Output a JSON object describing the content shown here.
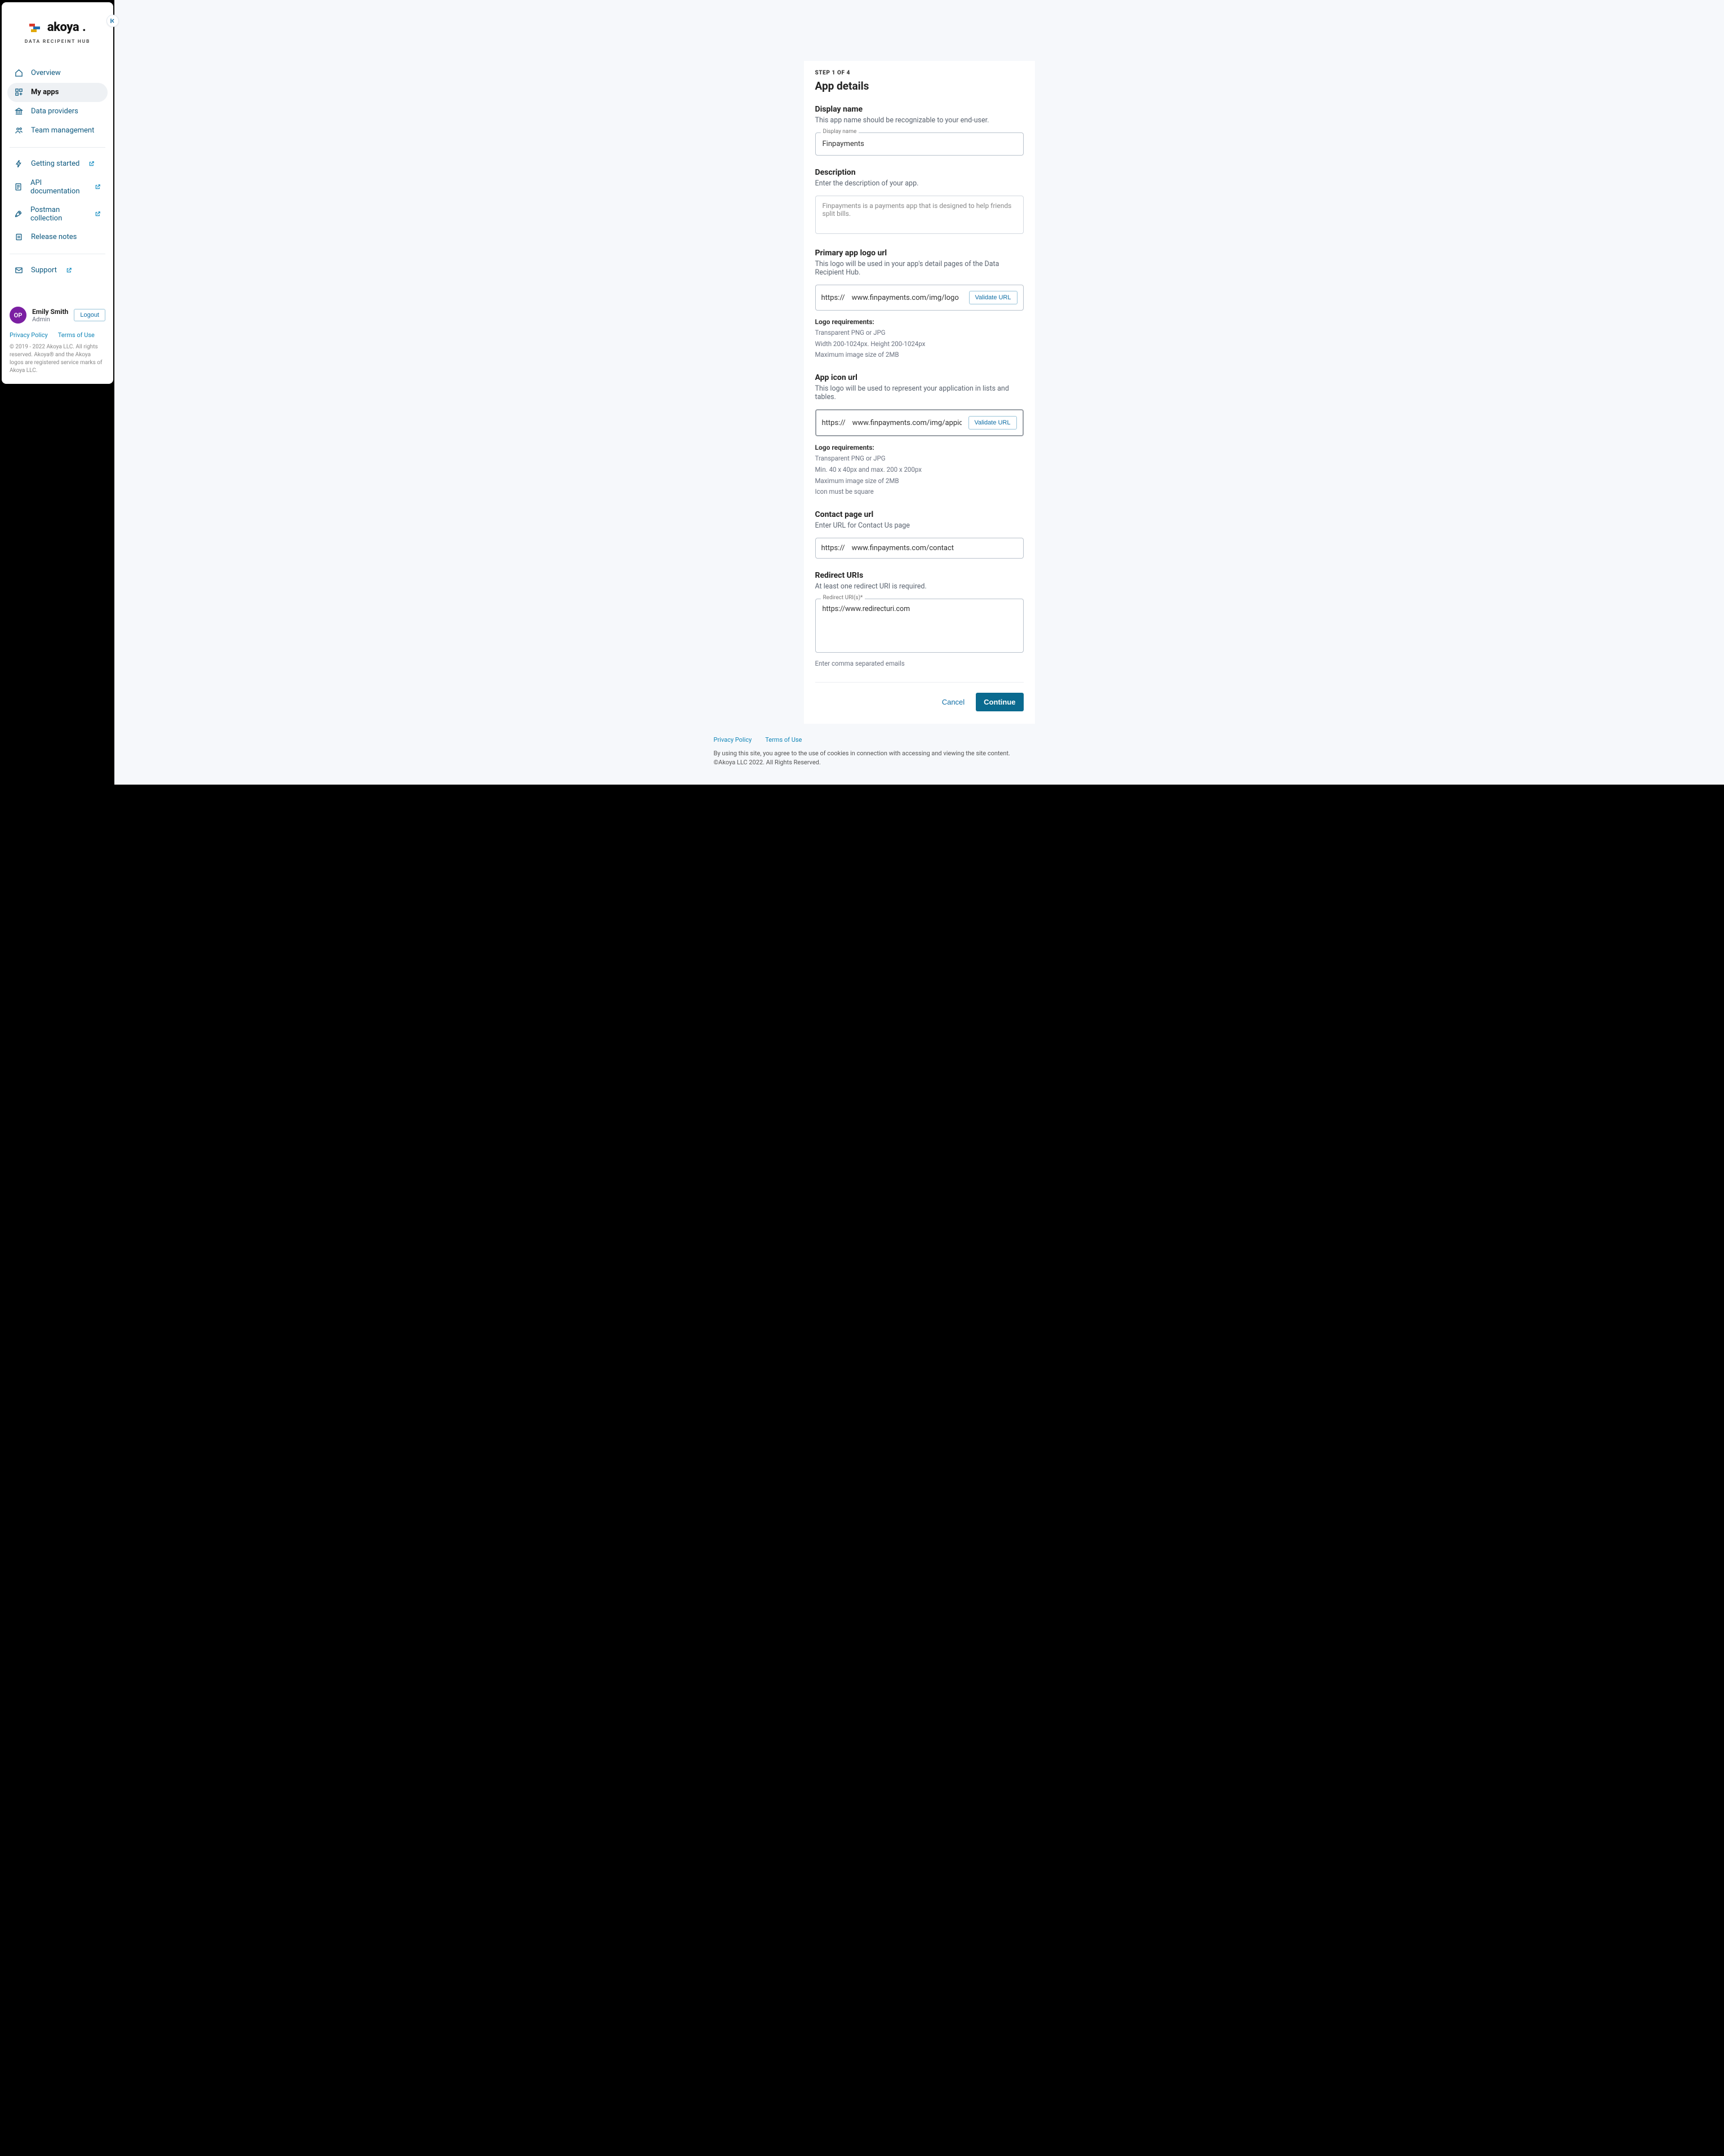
{
  "brand": {
    "name": "akoya",
    "dot": ".",
    "subtitle": "DATA RECIPEINT HUB"
  },
  "sidebar": {
    "nav_primary": [
      {
        "label": "Overview",
        "active": false
      },
      {
        "label": "My apps",
        "active": true
      },
      {
        "label": "Data providers",
        "active": false
      },
      {
        "label": "Team management",
        "active": false
      }
    ],
    "nav_secondary": [
      {
        "label": "Getting started",
        "ext": true
      },
      {
        "label": "API documentation",
        "ext": true
      },
      {
        "label": "Postman collection",
        "ext": true
      },
      {
        "label": "Release notes",
        "ext": false
      }
    ],
    "nav_tertiary": [
      {
        "label": "Support",
        "ext": true
      }
    ],
    "user": {
      "initials": "OP",
      "name": "Emily Smith",
      "role": "Admin",
      "logout": "Logout"
    },
    "legal": {
      "privacy": "Privacy Policy",
      "terms": "Terms of Use",
      "copy": "© 2019 - 2022 Akoya LLC. All rights reserved. Akoya® and the Akoya logos are registered service marks of Akoya LLC."
    }
  },
  "form": {
    "step": "STEP 1 OF 4",
    "title": "App details",
    "display_name": {
      "title": "Display name",
      "hint": "This app name should be recognizable to your end-user.",
      "label": "Display name",
      "value": "Finpayments"
    },
    "description": {
      "title": "Description",
      "hint": "Enter the description of your app.",
      "value": "Finpayments is a payments app that is designed to help friends split bills."
    },
    "primary_logo": {
      "title": "Primary app logo url",
      "hint": "This logo will be used in your app's detail pages of the Data Recipient Hub.",
      "proto": "https://",
      "value": "www.finpayments.com/img/logo",
      "validate": "Validate URL",
      "req_title": "Logo requirements:",
      "reqs": [
        "Transparent PNG or JPG",
        "Width 200-1024px. Height 200-1024px",
        "Maximum image size of 2MB"
      ]
    },
    "icon_url": {
      "title": "App icon url",
      "hint": "This logo will be used to represent your application in lists and tables.",
      "proto": "https://",
      "value": "www.finpayments.com/img/appicon",
      "validate": "Validate URL",
      "req_title": "Logo requirements:",
      "reqs": [
        "Transparent PNG or JPG",
        "Min. 40 x 40px and max. 200 x 200px",
        "Maximum image size of 2MB",
        "Icon must be square"
      ]
    },
    "contact": {
      "title": "Contact page url",
      "hint": "Enter URL for Contact Us page",
      "proto": "https://",
      "value": "www.finpayments.com/contact"
    },
    "redirect": {
      "title": "Redirect URIs",
      "hint": "At least one redirect URI is required.",
      "label": "Redirect URI(s)*",
      "value": "https://www.redirecturi.com",
      "helper": "Enter comma separated emails"
    },
    "actions": {
      "cancel": "Cancel",
      "continue": "Continue"
    }
  },
  "footer": {
    "privacy": "Privacy Policy",
    "terms": "Terms of Use",
    "line1": "By using this site, you agree to the use of cookies in connection with accessing and viewing the site content.",
    "line2": "©Akoya LLC 2022. All Rights Reserved."
  }
}
